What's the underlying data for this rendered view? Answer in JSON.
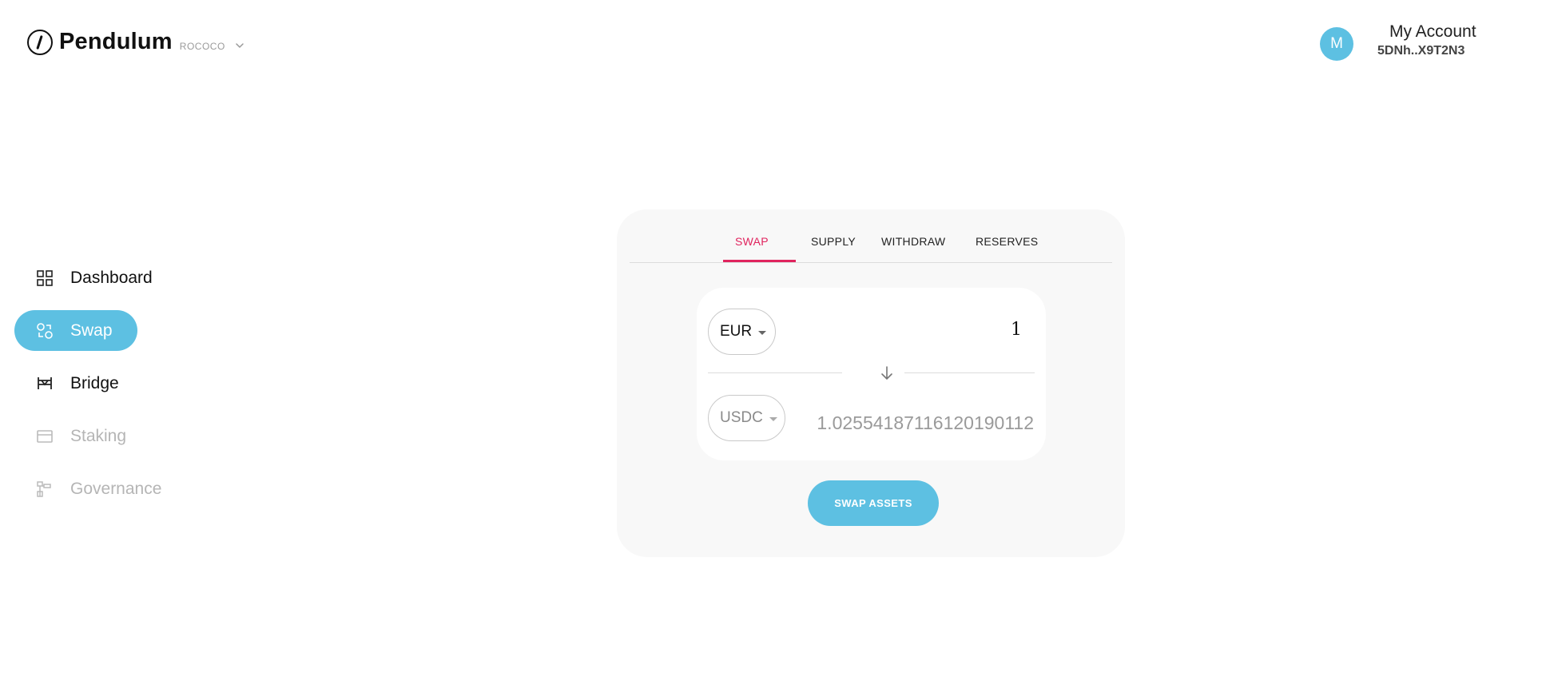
{
  "header": {
    "app_name": "Pendulum",
    "network": "ROCOCO",
    "account": {
      "avatar_initial": "M",
      "name": "My Account",
      "address": "5DNh..X9T2N3"
    }
  },
  "sidebar": {
    "items": [
      {
        "label": "Dashboard",
        "icon": "grid-icon",
        "state": "default"
      },
      {
        "label": "Swap",
        "icon": "swap-icon",
        "state": "active"
      },
      {
        "label": "Bridge",
        "icon": "bridge-icon",
        "state": "default"
      },
      {
        "label": "Staking",
        "icon": "staking-icon",
        "state": "disabled"
      },
      {
        "label": "Governance",
        "icon": "governance-icon",
        "state": "disabled"
      }
    ]
  },
  "card": {
    "tabs": [
      {
        "label": "SWAP",
        "active": true
      },
      {
        "label": "SUPPLY",
        "active": false
      },
      {
        "label": "WITHDRAW",
        "active": false
      },
      {
        "label": "RESERVES",
        "active": false
      }
    ],
    "from": {
      "token": "EUR",
      "amount": "1"
    },
    "to": {
      "token": "USDC",
      "amount": "1.02554187116120190112"
    },
    "swap_button": "SWAP ASSETS"
  },
  "colors": {
    "accent": "#5dc0e2",
    "tab_active": "#e0245e",
    "card_bg": "#f8f8f8",
    "disabled_text": "#b5b5b5"
  }
}
